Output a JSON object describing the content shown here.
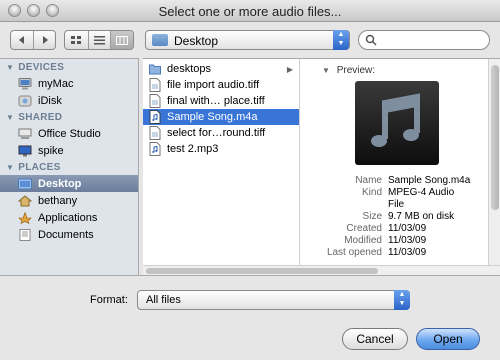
{
  "window": {
    "title": "Select one or more audio files..."
  },
  "toolbar": {
    "location": "Desktop",
    "search": {
      "placeholder": "",
      "value": ""
    },
    "nav_back_icon": "arrow-left-icon",
    "nav_forward_icon": "arrow-right-icon",
    "view_modes": [
      {
        "name": "icon-view-icon",
        "active": false
      },
      {
        "name": "list-view-icon",
        "active": false
      },
      {
        "name": "column-view-icon",
        "active": true
      }
    ]
  },
  "sidebar": {
    "sections": [
      {
        "title": "DEVICES",
        "items": [
          {
            "label": "myMac",
            "icon": "computer-icon"
          },
          {
            "label": "iDisk",
            "icon": "idisk-icon"
          }
        ]
      },
      {
        "title": "SHARED",
        "items": [
          {
            "label": "Office Studio",
            "icon": "network-computer-icon"
          },
          {
            "label": "spike",
            "icon": "network-display-icon"
          }
        ]
      },
      {
        "title": "PLACES",
        "items": [
          {
            "label": "Desktop",
            "icon": "desktop-folder-icon",
            "selected": true
          },
          {
            "label": "bethany",
            "icon": "home-icon"
          },
          {
            "label": "Applications",
            "icon": "applications-icon"
          },
          {
            "label": "Documents",
            "icon": "documents-folder-icon"
          }
        ]
      }
    ]
  },
  "files": [
    {
      "name": "desktops",
      "type": "folder",
      "has_children": true
    },
    {
      "name": "file import audio.tiff",
      "type": "image"
    },
    {
      "name": "final with… place.tiff",
      "type": "image"
    },
    {
      "name": "Sample Song.m4a",
      "type": "audio",
      "selected": true
    },
    {
      "name": "select for…round.tiff",
      "type": "image"
    },
    {
      "name": "test 2.mp3",
      "type": "audio"
    }
  ],
  "preview": {
    "header": "Preview:",
    "artwork_icon": "music-note-icon",
    "metadata": [
      {
        "key": "Name",
        "value": "Sample Song.m4a"
      },
      {
        "key": "Kind",
        "value": "MPEG-4 Audio"
      },
      {
        "key": "",
        "value": "File"
      },
      {
        "key": "Size",
        "value": "9.7 MB on disk"
      },
      {
        "key": "Created",
        "value": "11/03/09"
      },
      {
        "key": "Modified",
        "value": "11/03/09"
      },
      {
        "key": "Last opened",
        "value": "11/03/09"
      }
    ]
  },
  "format": {
    "label": "Format:",
    "value": "All files"
  },
  "buttons": {
    "cancel": "Cancel",
    "open": "Open"
  },
  "colors": {
    "selection": "#3875d7",
    "sidebar_selection": "#6b7d9c",
    "sidebar_bg": "#dee4ea",
    "primary_button": "#4d8de0"
  }
}
